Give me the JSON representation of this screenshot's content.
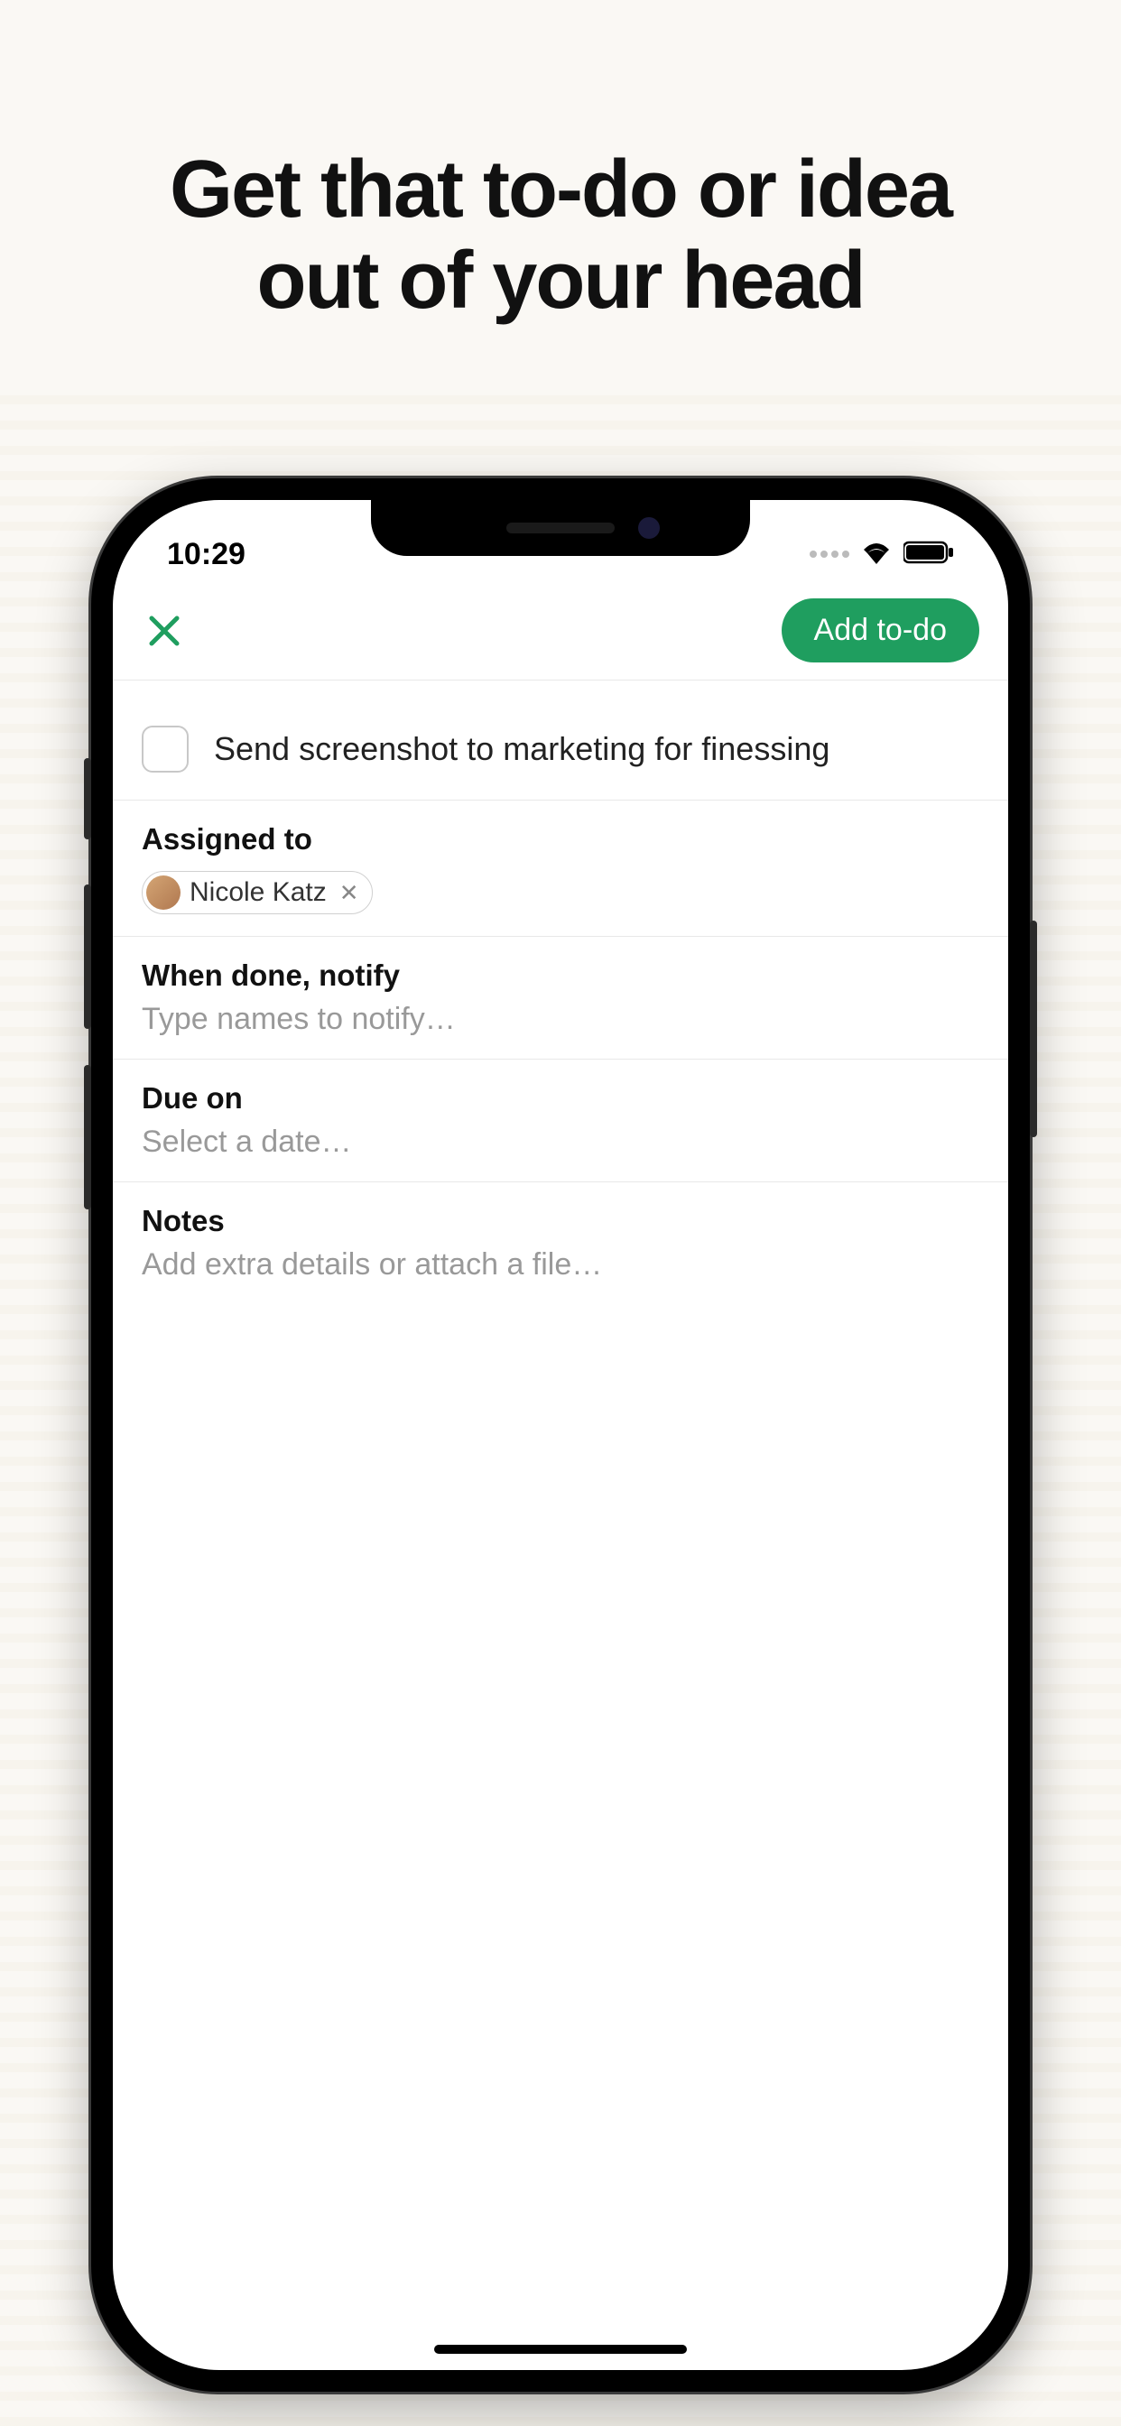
{
  "headline": {
    "line1": "Get that to-do or idea",
    "line2": "out of your head"
  },
  "statusBar": {
    "time": "10:29"
  },
  "navBar": {
    "addButtonLabel": "Add to-do"
  },
  "todo": {
    "title": "Send screenshot to marketing for finessing"
  },
  "fields": {
    "assignedTo": {
      "label": "Assigned to",
      "assignee": {
        "name": "Nicole Katz"
      }
    },
    "notify": {
      "label": "When done, notify",
      "placeholder": "Type names to notify…"
    },
    "dueOn": {
      "label": "Due on",
      "placeholder": "Select a date…"
    },
    "notes": {
      "label": "Notes",
      "placeholder": "Add extra details or attach a file…"
    }
  }
}
